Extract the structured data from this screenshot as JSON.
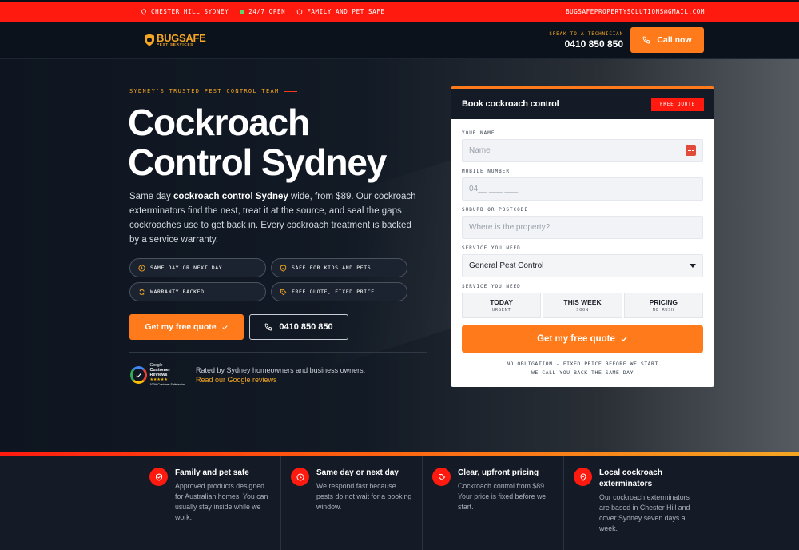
{
  "topbar": {
    "location": "CHESTER HILL SYDNEY",
    "open": "24/7 OPEN",
    "safe": "FAMILY AND PET SAFE",
    "email": "BUGSAFEPROPERTYSOLUTIONS@GMAIL.COM"
  },
  "header": {
    "logo_word": "BUGSAFE",
    "logo_sub": "PEST SERVICES",
    "speak_label": "SPEAK TO A TECHNICIAN",
    "phone": "0410 850 850",
    "call_label": "Call now"
  },
  "hero": {
    "eyebrow": "SYDNEY'S TRUSTED PEST CONTROL TEAM",
    "title_line1": "Cockroach",
    "title_line2": "Control Sydney",
    "intro_pre": "Same day ",
    "intro_bold": "cockroach control Sydney",
    "intro_post": " wide, from $89. Our cockroach exterminators find the nest, treat it at the source, and seal the gaps cockroaches use to get back in. Every cockroach treatment is backed by a service warranty.",
    "chips": [
      "SAME DAY OR NEXT DAY",
      "SAFE FOR KIDS AND PETS",
      "WARRANTY BACKED",
      "FREE QUOTE, FIXED PRICE"
    ],
    "quote_btn": "Get my free quote",
    "phone_btn": "0410 850 850",
    "rated_text": "Rated by Sydney homeowners and business owners.",
    "reviews_link": "Read our Google reviews",
    "badge_google": "Google",
    "badge_cr": "Customer Reviews",
    "badge_stars": "★★★★★",
    "badge_sat": "100% Customer Satisfaction"
  },
  "form": {
    "title": "Book cockroach control",
    "badge": "FREE QUOTE",
    "name_label": "YOUR NAME",
    "name_placeholder": "Name",
    "mobile_label": "MOBILE NUMBER",
    "mobile_placeholder": "04__ ___ ___",
    "suburb_label": "SUBURB OR POSTCODE",
    "suburb_placeholder": "Where is the property?",
    "service_label": "SERVICE YOU NEED",
    "service_value": "General Pest Control",
    "when_label": "SERVICE YOU NEED",
    "options": [
      {
        "title": "TODAY",
        "sub": "URGENT"
      },
      {
        "title": "THIS WEEK",
        "sub": "SOON"
      },
      {
        "title": "PRICING",
        "sub": "NO RUSH"
      }
    ],
    "submit": "Get my free quote",
    "note1": "NO OBLIGATION - FIXED PRICE BEFORE WE START",
    "note2": "WE CALL YOU BACK THE SAME DAY"
  },
  "features": [
    {
      "title": "Family and pet safe",
      "desc": "Approved products designed for Australian homes. You can usually stay inside while we work.",
      "icon": "shield-check-icon"
    },
    {
      "title": "Same day or next day",
      "desc": "We respond fast because pests do not wait for a booking window.",
      "icon": "clock-icon"
    },
    {
      "title": "Clear, upfront pricing",
      "desc": "Cockroach control from $89. Your price is fixed before we start.",
      "icon": "tag-icon"
    },
    {
      "title": "Local cockroach exterminators",
      "desc": "Our cockroach exterminators are based in Chester Hill and cover Sydney seven days a week.",
      "icon": "map-pin-icon"
    }
  ],
  "colors": {
    "accent_orange": "#ff7a1a",
    "accent_red": "#ff1a0f",
    "dark": "#0f1620",
    "gold": "#f5a623"
  }
}
